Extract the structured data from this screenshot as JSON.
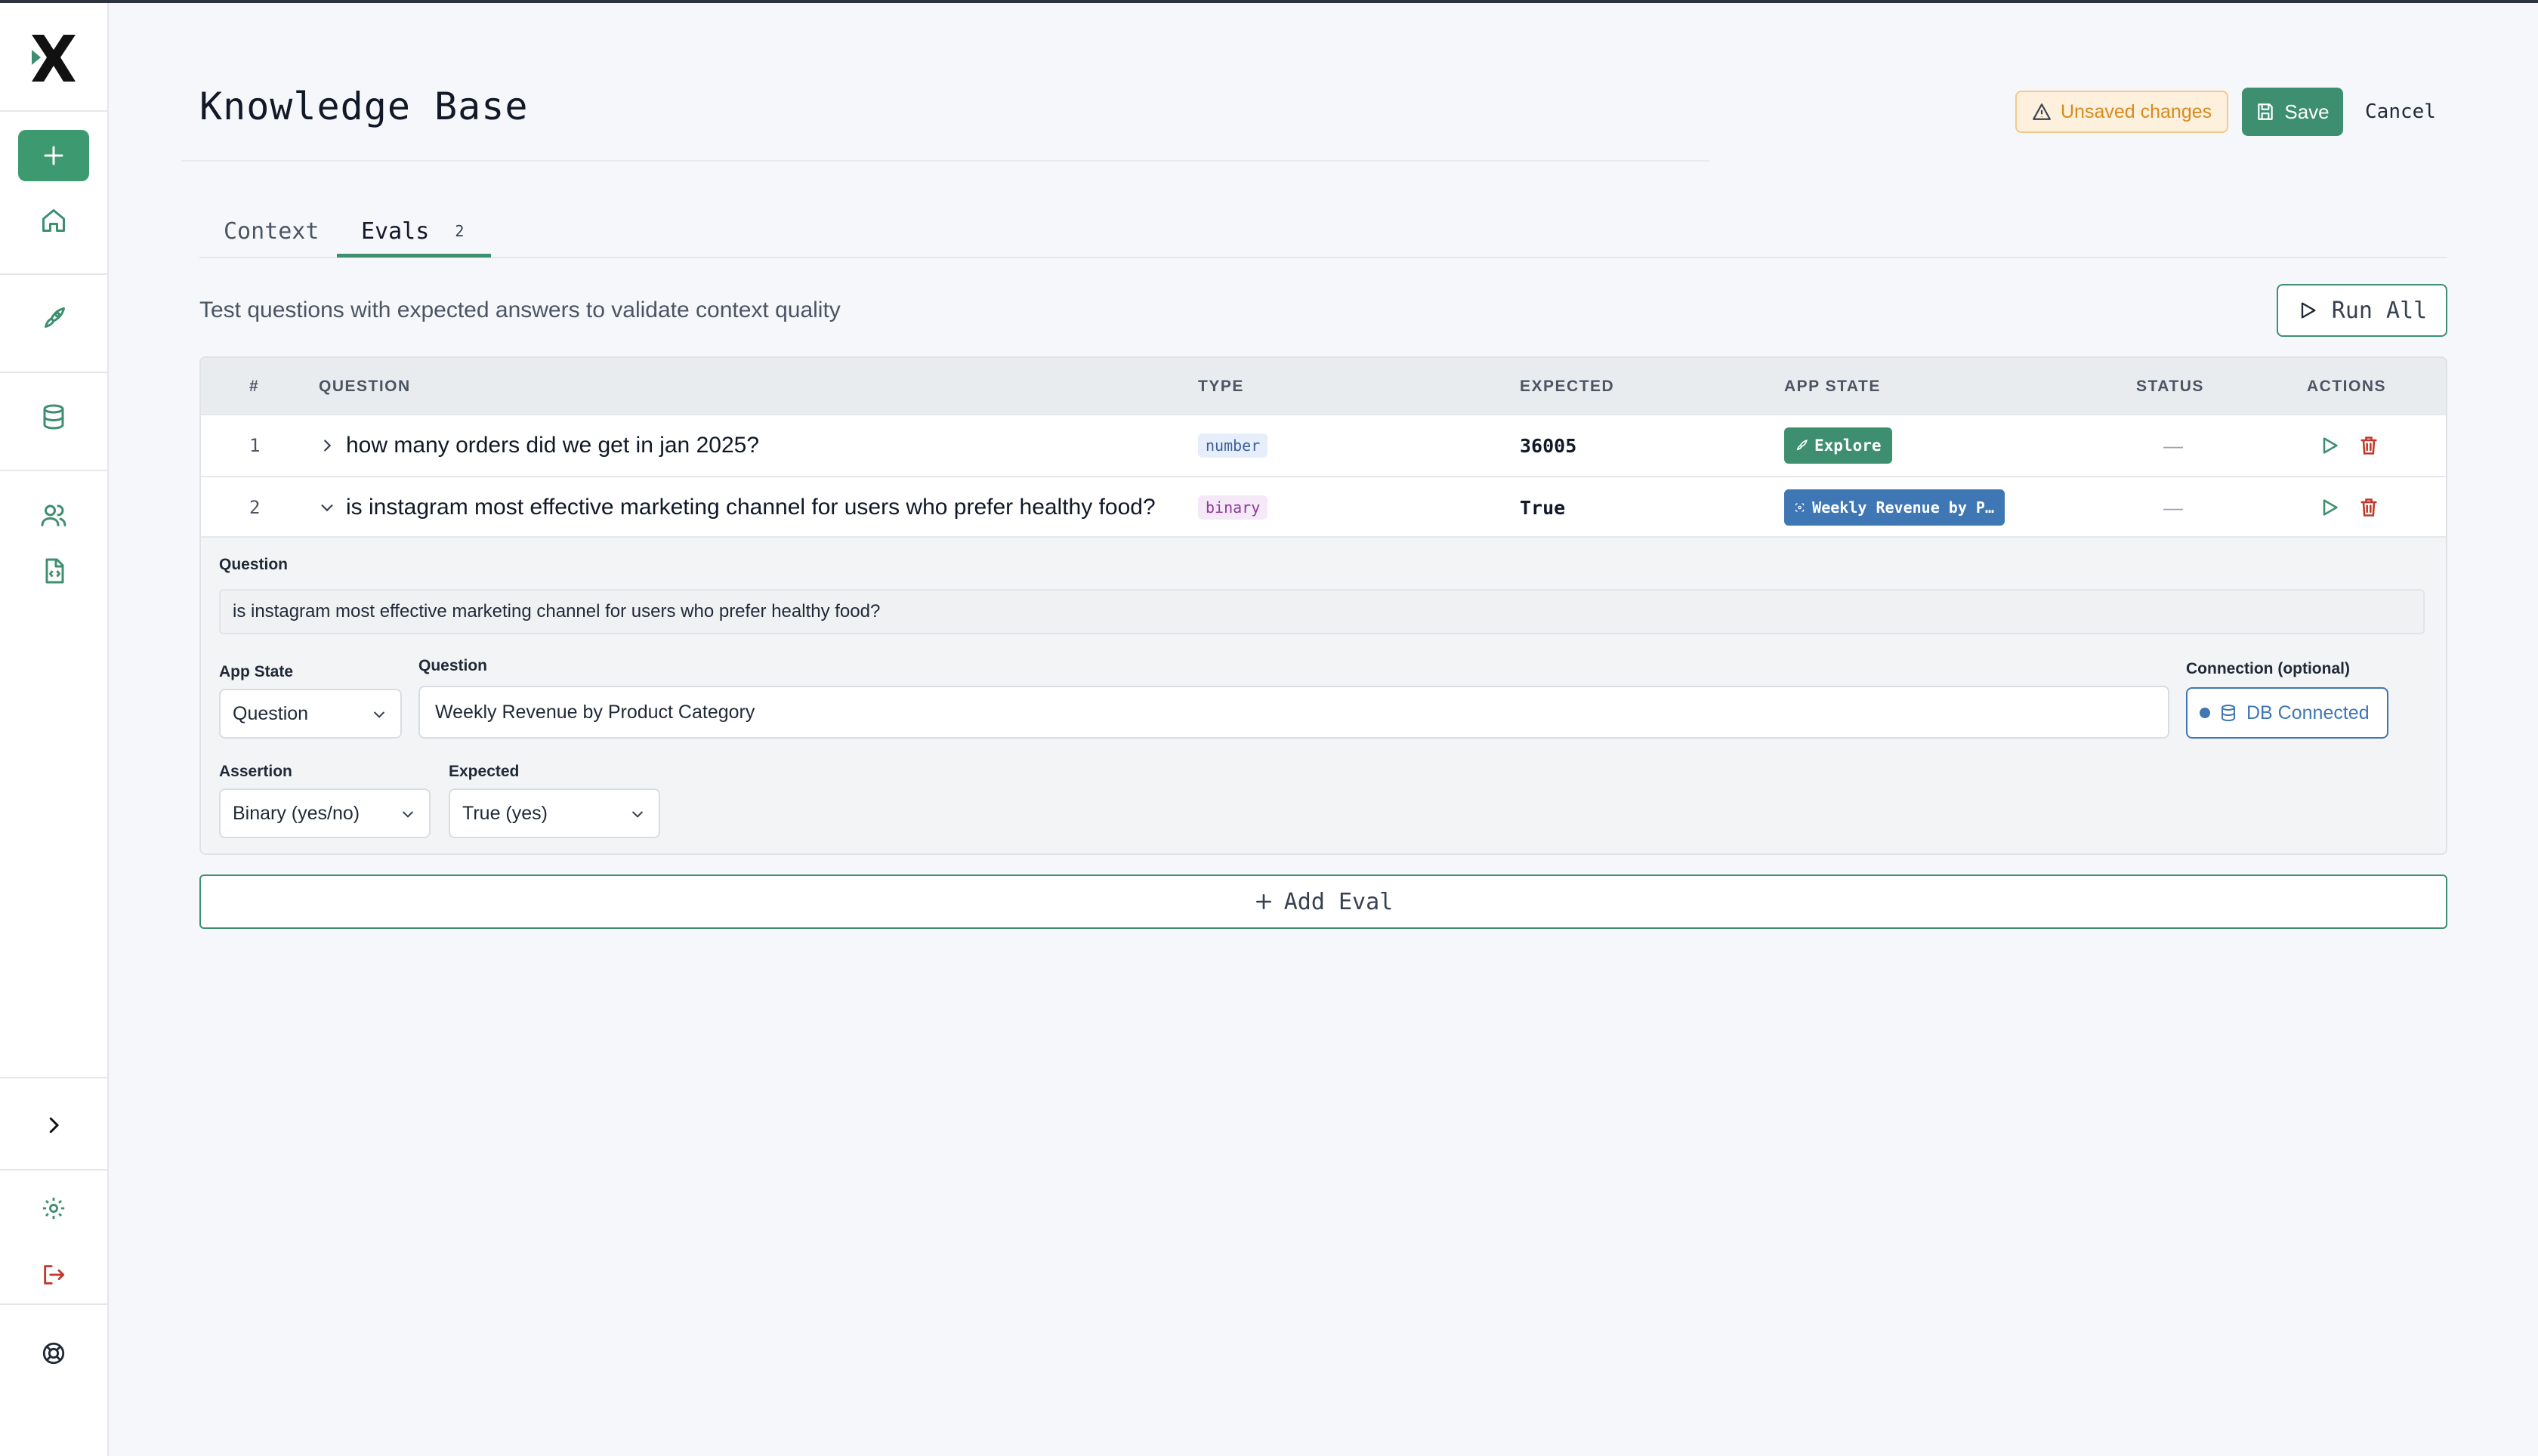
{
  "page": {
    "title": "Knowledge Base",
    "unsaved_label": "Unsaved changes",
    "save_label": "Save",
    "cancel_label": "Cancel"
  },
  "tabs": [
    {
      "label": "Context",
      "active": false
    },
    {
      "label": "Evals",
      "count": "2",
      "active": true
    }
  ],
  "evals": {
    "subtitle": "Test questions with expected answers to validate context quality",
    "run_all_label": "Run All",
    "columns": [
      "#",
      "QUESTION",
      "TYPE",
      "EXPECTED",
      "APP STATE",
      "STATUS",
      "ACTIONS"
    ],
    "rows": [
      {
        "num": "1",
        "question": "how many orders did we get in jan 2025?",
        "type": "number",
        "expected": "36005",
        "app_state": "Explore",
        "status": "—",
        "expanded": false
      },
      {
        "num": "2",
        "question": "is instagram most effective marketing channel for users who prefer healthy food?",
        "type": "binary",
        "expected": "True",
        "app_state": "Weekly Revenue by P…",
        "status": "—",
        "expanded": true
      }
    ],
    "editor": {
      "question_label": "Question",
      "question_value": "is instagram most effective marketing channel for users who prefer healthy food?",
      "app_state_label": "App State",
      "app_state_value": "Question",
      "target_question_label": "Question",
      "target_question_value": "Weekly Revenue by Product Category",
      "connection_label": "Connection (optional)",
      "connection_value": "DB Connected",
      "assertion_label": "Assertion",
      "assertion_value": "Binary (yes/no)",
      "expected_label": "Expected",
      "expected_value": "True (yes)"
    },
    "add_label": "Add Eval"
  },
  "colors": {
    "accent": "#3d8f70",
    "warning": "#d88a1e",
    "danger": "#c0392b",
    "blue": "#3f77b4"
  },
  "icons": [
    "logo-icon",
    "plus-icon",
    "home-icon",
    "rocket-icon",
    "database-icon",
    "users-icon",
    "code-file-icon",
    "chevron-right-icon",
    "gear-icon",
    "logout-icon",
    "help-icon",
    "warning-icon",
    "save-icon",
    "play-icon",
    "trash-icon",
    "chevron-down-icon"
  ]
}
